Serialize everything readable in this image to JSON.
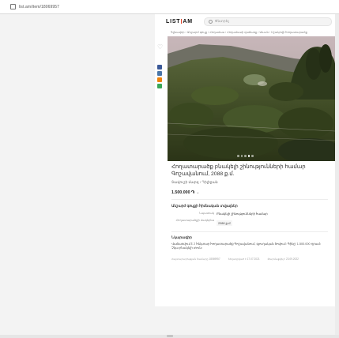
{
  "browser": {
    "url": "list.am/item/18069957"
  },
  "header": {
    "logo_left": "LIST",
    "logo_right": "AM",
    "search_placeholder": "Փնտրել"
  },
  "breadcrumb": "Գլխավոր › Անշարժ գույք › Հողամաս › Հողամասի վաճառք › Սևան › Մշակովի հողատարածք",
  "listing": {
    "title": "Հողատարածք բնակելի շինությունների համար Գոշավանում, 2088 ք.մ.",
    "location": "Տավուշի մարզ › Դիլիջան",
    "price": "1.500.000 ֏",
    "price_chevron": "⌄",
    "photo_count": 5,
    "photo_active": 3
  },
  "details": {
    "section_title": "Անշարժ գույքի հիմնական տվյալներ",
    "rows": [
      {
        "label": "Նպատակ",
        "value": "Բնակելի շինությունների համար"
      },
      {
        "label": "Հողատարածքի մակերես",
        "value": "2088 ք.մ."
      }
    ]
  },
  "description": {
    "section_title": "Նկարագիր",
    "text": "Վաճառվում է 2 հեկտար հողատարածք Գոշավանում, գյուղական ծովում։ Գինը՝ 1.500.000 դրամ։ Չկա բնակելի տուն։"
  },
  "meta": {
    "ad_id": "Հայտարարության համարը 18069957",
    "posted": "Տեղադրված է 17.07.2021",
    "updated": "Թարմացվել է 23.09.2022"
  },
  "share": {
    "facebook_color": "#3b5998",
    "vk_color": "#4a76a8",
    "ok_color": "#ee8208",
    "other_color": "#3aa757"
  }
}
